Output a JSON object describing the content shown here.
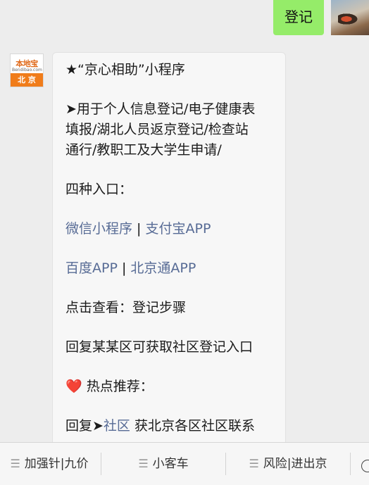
{
  "outgoing": {
    "text": "登记"
  },
  "avatar": {
    "brand": "本地宝",
    "domain": "Bendibao.com",
    "city": "北 京"
  },
  "message": {
    "title": "★“京心相助”小程序",
    "desc_lines": [
      "➤用于个人信息登记/电子健康表",
      "填报/湖北人员返京登记/检查站",
      "通行/教职工及大学生申请/"
    ],
    "entry_label": "四种入口：",
    "entries_row1": [
      "微信小程序",
      "支付宝APP"
    ],
    "entries_row2": [
      "百度APP",
      "北京通APP"
    ],
    "separator": " | ",
    "view_steps": "点击查看：登记步骤",
    "reply_district": "回复某某区可获取社区登记入口",
    "hot_heart": "❤️",
    "hot_label": " 热点推荐：",
    "reply_prefix": "回复➤",
    "reply_link": "社区",
    "reply_suffix": " 获北京各区社区联系"
  },
  "menu": {
    "items": [
      "加强针|九价",
      "小客车",
      "风险|进出京"
    ],
    "menu_icon": "menu-lines-icon",
    "keyboard_icon": "keyboard-toggle-icon"
  }
}
